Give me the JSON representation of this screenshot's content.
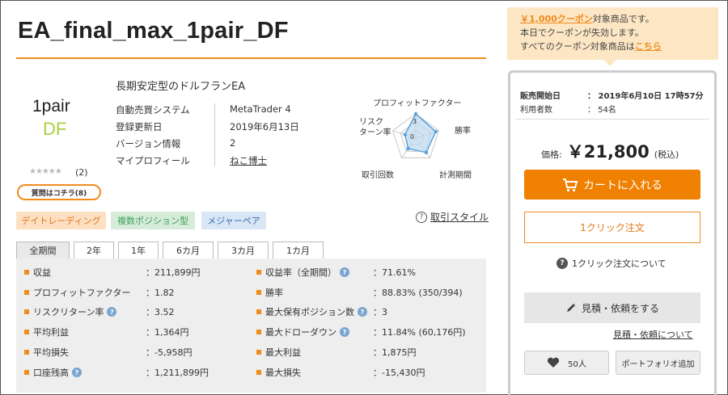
{
  "product": {
    "title": "EA_final_max_1pair_DF",
    "logo_line1": "1pair",
    "logo_line2": "DF",
    "stars": "★★★★★",
    "review_count": "(2)",
    "qa_label": "質問はコチラ(8)",
    "tagline": "長期安定型のドルフランEA",
    "info": [
      {
        "label": "自動売買システム",
        "value": "MetaTrader 4"
      },
      {
        "label": "登録更新日",
        "value": "2019年6月13日"
      },
      {
        "label": "バージョン情報",
        "value": "2"
      },
      {
        "label": "マイプロフィール",
        "value": "ねこ博士"
      }
    ]
  },
  "radar": {
    "title": "プロフィットファクター",
    "risk_label": "リスク\nターン率",
    "win_label": "勝率",
    "trades_label": "取引回数",
    "period_label": "計測期間",
    "scale_max": "3",
    "scale_zero": "0",
    "levels": 3,
    "values": [
      3.0,
      2.6,
      2.2,
      1.6,
      1.4
    ],
    "colors": {
      "fill": "#bcd8f0",
      "stroke": "#5aa0da",
      "grid": "#bbbbbb"
    }
  },
  "tags": [
    "デイトレーディング",
    "複数ポジション型",
    "メジャーペア"
  ],
  "style_link": "取引スタイル",
  "tabs": [
    "全期間",
    "2年",
    "1年",
    "6カ月",
    "3カ月",
    "1カ月"
  ],
  "stats_left": [
    {
      "label": "収益",
      "value": "：211,899円",
      "help": false
    },
    {
      "label": "プロフィットファクター",
      "value": "：1.82",
      "help": false
    },
    {
      "label": "リスクリターン率",
      "value": "：3.52",
      "help": true
    },
    {
      "label": "平均利益",
      "value": "：1,364円",
      "help": false
    },
    {
      "label": "平均損失",
      "value": "：-5,958円",
      "help": false
    },
    {
      "label": "口座残高",
      "value": "：1,211,899円",
      "help": true
    }
  ],
  "stats_right": [
    {
      "label": "収益率（全期間）",
      "value": "：71.61%",
      "help": true
    },
    {
      "label": "勝率",
      "value": "：88.83% (350/394)",
      "help": false
    },
    {
      "label": "最大保有ポジション数",
      "value": "：3",
      "help": true
    },
    {
      "label": "最大ドローダウン",
      "value": "：11.84% (60,176円)",
      "help": true
    },
    {
      "label": "最大利益",
      "value": "：1,875円",
      "help": false
    },
    {
      "label": "最大損失",
      "value": "：-15,430円",
      "help": false
    }
  ],
  "coupon": {
    "line1_link": "￥1,000クーポン",
    "line1_rest": "対象商品です。",
    "line2": "本日でクーポンが失効します。",
    "line3_pre": "すべてのクーポン対象商品は",
    "line3_link": "こちら"
  },
  "sidebar": {
    "release_label": "販売開始日",
    "release_value": "： 2019年6月10日 17時57分",
    "users_label": "利用者数",
    "users_value": "： 54名",
    "price_label": "価格:",
    "price_value": "￥21,800",
    "price_tax": "(税込)",
    "cart_label": "カートに入れる",
    "oneclick_label": "1クリック注文",
    "about_oneclick": "1クリック注文について",
    "quote_label": "見積・依頼をする",
    "about_quote": "見積・依頼について",
    "fav_count": "50人",
    "portfolio_label": "ポートフォリオ追加"
  },
  "colors": {
    "accent": "#f08c1e",
    "cart": "#f08000"
  }
}
